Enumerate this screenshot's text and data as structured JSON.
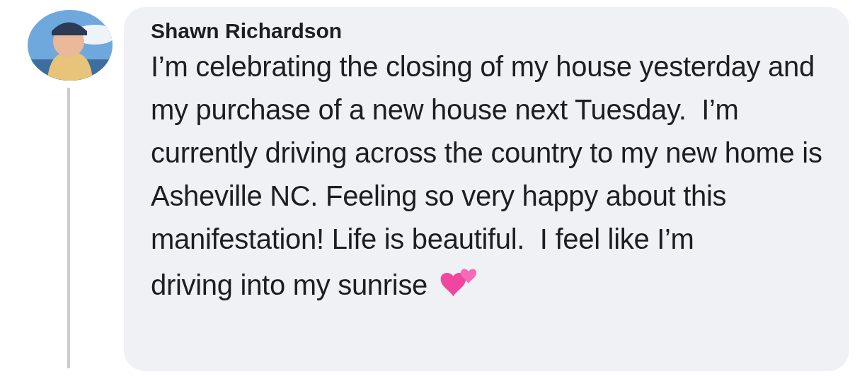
{
  "comment": {
    "author": "Shawn Richardson",
    "text": "I’m celebrating the closing of my house yesterday and my purchase of a new house next Tuesday.  I’m currently driving across the country to my new home is Asheville NC. Feeling so very happy about this manifestation! Life is beautiful.  I feel like I’m",
    "text_end": "driving into my sunrise"
  }
}
